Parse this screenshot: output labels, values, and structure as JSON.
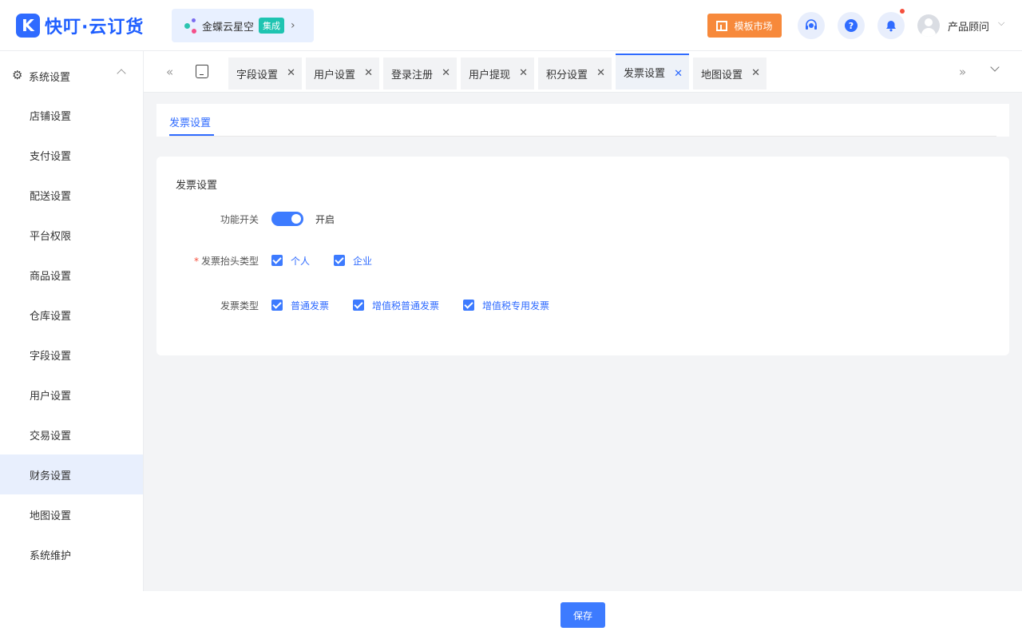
{
  "header": {
    "logo_mark": "K",
    "logo_text": "快叮·云订货",
    "integration_name": "金蝶云星空",
    "integration_badge": "集成",
    "market_label": "模板市场",
    "help_glyph": "?",
    "user_name": "产品顾问"
  },
  "sidebar": {
    "group_label": "系统设置",
    "items": [
      {
        "label": "店铺设置"
      },
      {
        "label": "支付设置"
      },
      {
        "label": "配送设置"
      },
      {
        "label": "平台权限"
      },
      {
        "label": "商品设置"
      },
      {
        "label": "仓库设置"
      },
      {
        "label": "字段设置"
      },
      {
        "label": "用户设置"
      },
      {
        "label": "交易设置"
      },
      {
        "label": "财务设置"
      },
      {
        "label": "地图设置"
      },
      {
        "label": "系统维护"
      }
    ],
    "active_item": "财务设置"
  },
  "tabs": [
    {
      "label": "字段设置"
    },
    {
      "label": "用户设置"
    },
    {
      "label": "登录注册"
    },
    {
      "label": "用户提现"
    },
    {
      "label": "积分设置"
    },
    {
      "label": "发票设置"
    },
    {
      "label": "地图设置"
    }
  ],
  "active_tab": "发票设置",
  "sub_tab": "发票设置",
  "form": {
    "title": "发票设置",
    "switch_label": "功能开关",
    "switch_state": "开启",
    "header_type_label": "发票抬头类型",
    "header_types": [
      {
        "label": "个人",
        "checked": true
      },
      {
        "label": "企业",
        "checked": true
      }
    ],
    "invoice_type_label": "发票类型",
    "invoice_types": [
      {
        "label": "普通发票",
        "checked": true
      },
      {
        "label": "增值税普通发票",
        "checked": true
      },
      {
        "label": "增值税专用发票",
        "checked": true
      }
    ]
  },
  "footer": {
    "save_label": "保存"
  },
  "colors": {
    "primary": "#2f6bff",
    "market": "#f7893b",
    "badge": "#1fc4b1"
  }
}
